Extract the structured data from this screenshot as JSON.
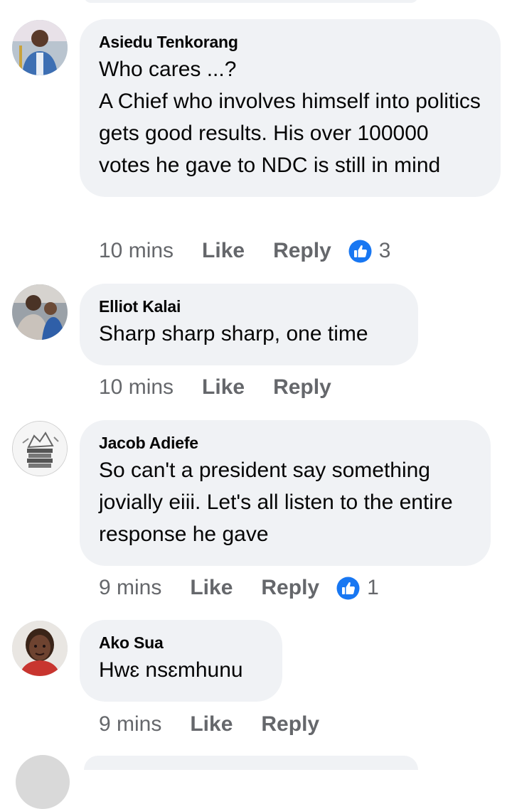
{
  "accent_color": "#1877f2",
  "secondary_text_color": "#65676b",
  "bubble_color": "#f0f2f5",
  "comments": [
    {
      "author": "Asiedu Tenkorang",
      "text": "Who cares ...?\nA Chief who involves himself into politics gets good results. His over 100000 votes he gave to NDC is still in mind",
      "time": "10 mins",
      "like_label": "Like",
      "reply_label": "Reply",
      "reaction_icon": "like-thumbs-up-icon",
      "reaction_count": "3"
    },
    {
      "author": "Elliot Kalai",
      "text": "Sharp sharp sharp, one time",
      "time": "10 mins",
      "like_label": "Like",
      "reply_label": "Reply"
    },
    {
      "author": "Jacob Adiefe",
      "text": "So can't a president say something jovially eiii.  Let's all listen to the entire response he gave",
      "time": "9 mins",
      "like_label": "Like",
      "reply_label": "Reply",
      "reaction_icon": "like-thumbs-up-icon",
      "reaction_count": "1"
    },
    {
      "author": "Ako Sua",
      "text": "Hwɛ nsɛmhunu",
      "time": "9 mins",
      "like_label": "Like",
      "reply_label": "Reply"
    }
  ]
}
